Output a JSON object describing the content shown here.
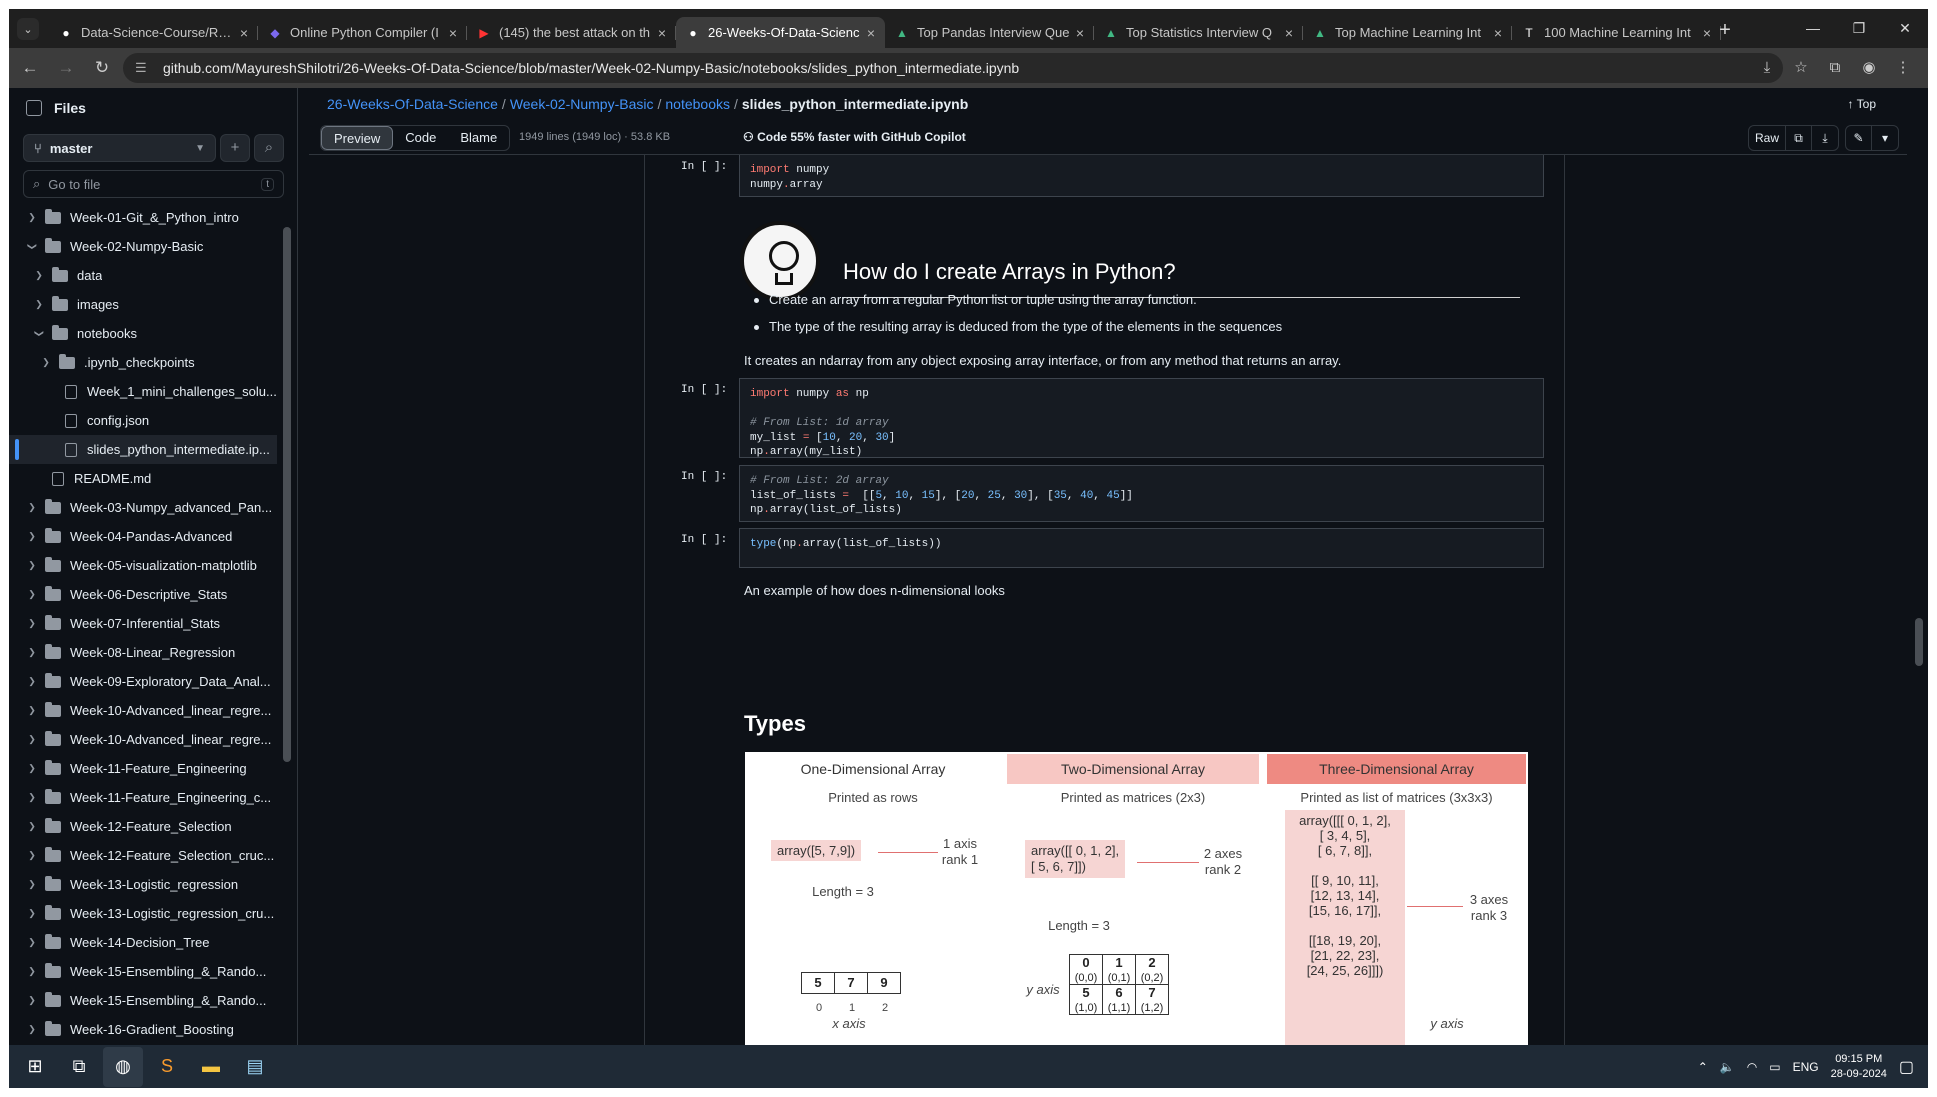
{
  "browser": {
    "tabs": [
      {
        "title": "Data-Science-Course/REA",
        "icon": "github-icon",
        "active": false
      },
      {
        "title": "Online Python Compiler (I",
        "icon": "python-icon",
        "active": false
      },
      {
        "title": "(145) the best attack on th",
        "icon": "youtube-icon",
        "active": false
      },
      {
        "title": "26-Weeks-Of-Data-Scienc",
        "icon": "github-icon",
        "active": true
      },
      {
        "title": "Top Pandas Interview Que",
        "icon": "mountain-icon",
        "active": false
      },
      {
        "title": "Top Statistics Interview Q",
        "icon": "mountain-icon",
        "active": false
      },
      {
        "title": "Top Machine Learning Int",
        "icon": "mountain-icon",
        "active": false
      },
      {
        "title": "100 Machine Learning Int",
        "icon": "medium-icon",
        "active": false
      }
    ],
    "url": "github.com/MayureshShilotri/26-Weeks-Of-Data-Science/blob/master/Week-02-Numpy-Basic/notebooks/slides_python_intermediate.ipynb"
  },
  "sidebar": {
    "title": "Files",
    "branch": "master",
    "goto_placeholder": "Go to file",
    "goto_kbd": "t",
    "items": [
      {
        "label": "Week-01-Git_&_Python_intro",
        "type": "folder",
        "chev": "›",
        "indent": 0
      },
      {
        "label": "Week-02-Numpy-Basic",
        "type": "folder",
        "chev": "⌄",
        "indent": 0
      },
      {
        "label": "data",
        "type": "folder",
        "chev": "›",
        "indent": 1
      },
      {
        "label": "images",
        "type": "folder",
        "chev": "›",
        "indent": 1
      },
      {
        "label": "notebooks",
        "type": "folder",
        "chev": "⌄",
        "indent": 1
      },
      {
        "label": ".ipynb_checkpoints",
        "type": "folder",
        "chev": "›",
        "indent": 2
      },
      {
        "label": "Week_1_mini_challenges_solu...",
        "type": "file",
        "chev": "",
        "indent": 2
      },
      {
        "label": "config.json",
        "type": "file",
        "chev": "",
        "indent": 2
      },
      {
        "label": "slides_python_intermediate.ip...",
        "type": "file",
        "chev": "",
        "indent": 2,
        "selected": true
      },
      {
        "label": "README.md",
        "type": "file",
        "chev": "",
        "indent": 1
      },
      {
        "label": "Week-03-Numpy_advanced_Pan...",
        "type": "folder",
        "chev": "›",
        "indent": 0
      },
      {
        "label": "Week-04-Pandas-Advanced",
        "type": "folder",
        "chev": "›",
        "indent": 0
      },
      {
        "label": "Week-05-visualization-matplotlib",
        "type": "folder",
        "chev": "›",
        "indent": 0
      },
      {
        "label": "Week-06-Descriptive_Stats",
        "type": "folder",
        "chev": "›",
        "indent": 0
      },
      {
        "label": "Week-07-Inferential_Stats",
        "type": "folder",
        "chev": "›",
        "indent": 0
      },
      {
        "label": "Week-08-Linear_Regression",
        "type": "folder",
        "chev": "›",
        "indent": 0
      },
      {
        "label": "Week-09-Exploratory_Data_Anal...",
        "type": "folder",
        "chev": "›",
        "indent": 0
      },
      {
        "label": "Week-10-Advanced_linear_regre...",
        "type": "folder",
        "chev": "›",
        "indent": 0
      },
      {
        "label": "Week-10-Advanced_linear_regre...",
        "type": "folder",
        "chev": "›",
        "indent": 0
      },
      {
        "label": "Week-11-Feature_Engineering",
        "type": "folder",
        "chev": "›",
        "indent": 0
      },
      {
        "label": "Week-11-Feature_Engineering_c...",
        "type": "folder",
        "chev": "›",
        "indent": 0
      },
      {
        "label": "Week-12-Feature_Selection",
        "type": "folder",
        "chev": "›",
        "indent": 0
      },
      {
        "label": "Week-12-Feature_Selection_cruc...",
        "type": "folder",
        "chev": "›",
        "indent": 0
      },
      {
        "label": "Week-13-Logistic_regression",
        "type": "folder",
        "chev": "›",
        "indent": 0
      },
      {
        "label": "Week-13-Logistic_regression_cru...",
        "type": "folder",
        "chev": "›",
        "indent": 0
      },
      {
        "label": "Week-14-Decision_Tree",
        "type": "folder",
        "chev": "›",
        "indent": 0
      },
      {
        "label": "Week-15-Ensembling_&_Rando...",
        "type": "folder",
        "chev": "›",
        "indent": 0
      },
      {
        "label": "Week-15-Ensembling_&_Rando...",
        "type": "folder",
        "chev": "›",
        "indent": 0
      },
      {
        "label": "Week-16-Gradient_Boosting",
        "type": "folder",
        "chev": "›",
        "indent": 0
      }
    ]
  },
  "breadcrumb": {
    "parts": [
      "26-Weeks-Of-Data-Science",
      "Week-02-Numpy-Basic",
      "notebooks"
    ],
    "current": "slides_python_intermediate.ipynb",
    "top": "Top"
  },
  "filebar": {
    "tabs": [
      "Preview",
      "Code",
      "Blame"
    ],
    "info": "1949 lines (1949 loc) · 53.8 KB",
    "copilot": "Code 55% faster with GitHub Copilot",
    "raw": "Raw"
  },
  "notebook": {
    "prompt": "In [ ]:",
    "cell1": [
      "import numpy",
      "numpy.array"
    ],
    "heading": "How do I create Arrays in Python?",
    "bullets": [
      "Create an array from a regular Python list or tuple using the array function.",
      "The type of the resulting array is deduced from the type of the elements in the sequences"
    ],
    "para1": "It creates an ndarray from any object exposing array interface, or from any method that returns an array.",
    "para2": "An example of how does n-dimensional looks",
    "types_heading": "Types"
  },
  "figure": {
    "headers": [
      "One-Dimensional Array",
      "Two-Dimensional Array",
      "Three-Dimensional Array"
    ],
    "header_colors": [
      "#f5d6d4",
      "#f7c7c3",
      "#ee8a82"
    ],
    "subs": [
      "Printed as rows",
      "Printed as matrices (2x3)",
      "Printed as list of matrices (3x3x3)"
    ],
    "one": {
      "code": "array([5, 7,9])",
      "axes": "1 axis",
      "rank": "rank 1",
      "length": "Length = 3",
      "cells": [
        "5",
        "7",
        "9"
      ],
      "idx": [
        "0",
        "1",
        "2"
      ],
      "xaxis": "x axis"
    },
    "two": {
      "code1": "array([[ 0, 1, 2],",
      "code2": " [ 5, 6, 7]])",
      "axes": "2 axes",
      "rank": "rank 2",
      "length": "Length = 3",
      "yaxis": "y axis",
      "cells": [
        [
          "0",
          "(0,0)"
        ],
        [
          "1",
          "(0,1)"
        ],
        [
          "2",
          "(0,2)"
        ],
        [
          "5",
          "(1,0)"
        ],
        [
          "6",
          "(1,1)"
        ],
        [
          "7",
          "(1,2)"
        ]
      ]
    },
    "three": {
      "lines": [
        "array([[[ 0, 1, 2],",
        "[ 3, 4, 5],",
        "[ 6, 7, 8]],",
        "",
        "[[ 9, 10, 11],",
        "[12, 13, 14],",
        "[15, 16, 17]],",
        "",
        "[[18, 19, 20],",
        "[21, 22, 23],",
        "[24, 25, 26]]])"
      ],
      "axes": "3 axes",
      "rank": "rank 3",
      "yaxis": "y axis"
    }
  },
  "taskbar": {
    "lang": "ENG",
    "time": "09:15 PM",
    "date": "28-09-2024"
  },
  "colors": {
    "accent": "#4493f8",
    "page_bg": "#0d1117",
    "border": "#30363d"
  }
}
